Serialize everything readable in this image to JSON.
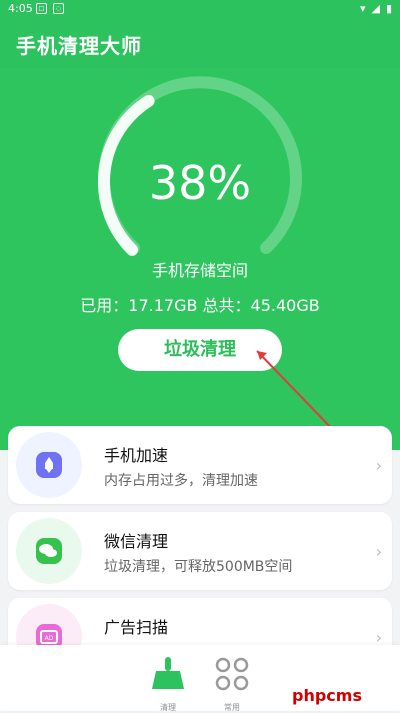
{
  "status": {
    "time": "4:05"
  },
  "header": {
    "title": "手机清理大师"
  },
  "storage": {
    "percent": "38%",
    "percent_value": 38,
    "label": "手机存储空间",
    "usage_text": "已用：17.17GB   总共：45.40GB",
    "button_label": "垃圾清理"
  },
  "features": [
    {
      "title": "手机加速",
      "subtitle": "内存占用过多，清理加速",
      "icon": "rocket-icon",
      "accent": "#6f72f3",
      "bg": "#eef3ff"
    },
    {
      "title": "微信清理",
      "subtitle": "垃圾清理，可释放500MB空间",
      "icon": "wechat-icon",
      "accent": "#37c24e",
      "bg": "#eaf9ee"
    },
    {
      "title": "广告扫描",
      "subtitle": "",
      "icon": "ad-icon",
      "accent": "#e76ad6",
      "bg": "#fcecf8"
    }
  ],
  "nav": [
    {
      "label": "清理",
      "icon": "clean-broom-icon",
      "active": true
    },
    {
      "label": "常用",
      "icon": "apps-grid-icon",
      "active": false
    }
  ],
  "watermark": "phpcms",
  "colors": {
    "primary": "#2cc35f",
    "hero": "#2ec55f",
    "button_text": "#2cbf59",
    "arrow": "#e43a3a"
  }
}
